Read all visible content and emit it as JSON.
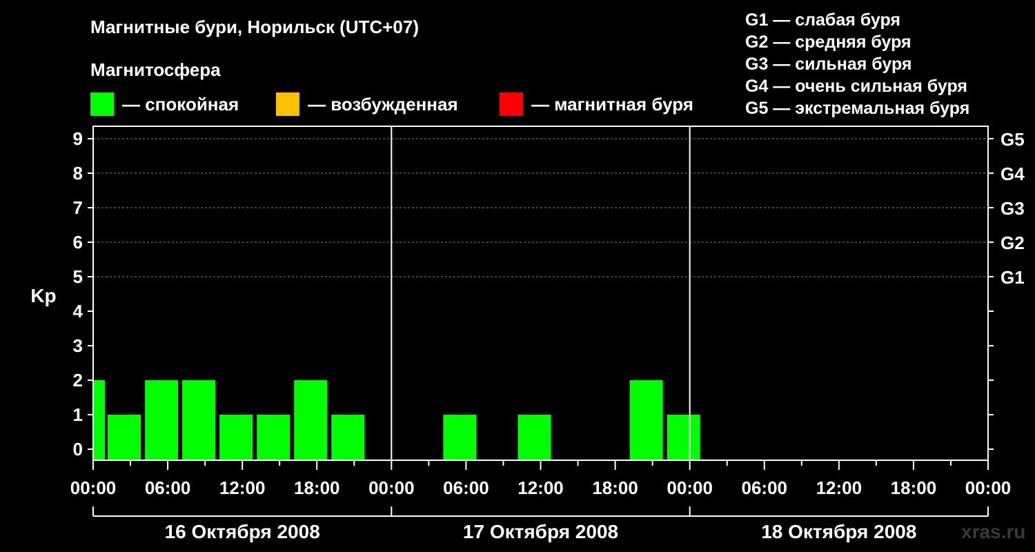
{
  "colors": {
    "quiet": "#00ff00",
    "active": "#ffc000",
    "storm": "#ff0000",
    "background": "#000000",
    "axis": "#ffffff",
    "grid": "#888888"
  },
  "legend": {
    "heading": "Магнитосфера",
    "items": [
      {
        "label": "— спокойная",
        "color": "#00ff00"
      },
      {
        "label": "— возбужденная",
        "color": "#ffc000"
      },
      {
        "label": "— магнитная буря",
        "color": "#ff0000"
      }
    ]
  },
  "g_legend": [
    "G1 — слабая буря",
    "G2 — средняя буря",
    "G3 — сильная буря",
    "G4 — очень сильная буря",
    "G5 — экстремальная буря"
  ],
  "watermark": "xras.ru",
  "chart_data": {
    "type": "bar",
    "title": "Магнитные бури, Норильск (UTC+07)",
    "ylabel": "Kp",
    "ylim": [
      0,
      9
    ],
    "yticks": [
      "0",
      "1",
      "2",
      "3",
      "4",
      "5",
      "6",
      "7",
      "8",
      "9"
    ],
    "right_axis": [
      {
        "kp": 5,
        "label": "G1"
      },
      {
        "kp": 6,
        "label": "G2"
      },
      {
        "kp": 7,
        "label": "G3"
      },
      {
        "kp": 8,
        "label": "G4"
      },
      {
        "kp": 9,
        "label": "G5"
      }
    ],
    "grid": true,
    "xticks": [
      "00:00",
      "06:00",
      "12:00",
      "18:00",
      "00:00",
      "06:00",
      "12:00",
      "18:00",
      "00:00",
      "06:00",
      "12:00",
      "18:00",
      "00:00"
    ],
    "days": [
      "16 Октября 2008",
      "17 Октября 2008",
      "18 Октября 2008"
    ],
    "series": [
      {
        "bars": [
          {
            "start": "2008-10-16 00:00",
            "end": "2008-10-16 01:00",
            "value": 2
          },
          {
            "start": "2008-10-16 01:00",
            "end": "2008-10-16 04:00",
            "value": 1
          },
          {
            "start": "2008-10-16 04:00",
            "end": "2008-10-16 07:00",
            "value": 2
          },
          {
            "start": "2008-10-16 07:00",
            "end": "2008-10-16 10:00",
            "value": 2
          },
          {
            "start": "2008-10-16 10:00",
            "end": "2008-10-16 13:00",
            "value": 1
          },
          {
            "start": "2008-10-16 13:00",
            "end": "2008-10-16 16:00",
            "value": 1
          },
          {
            "start": "2008-10-16 16:00",
            "end": "2008-10-16 19:00",
            "value": 2
          },
          {
            "start": "2008-10-16 19:00",
            "end": "2008-10-16 22:00",
            "value": 1
          },
          {
            "start": "2008-10-16 22:00",
            "end": "2008-10-17 01:00",
            "value": 0
          },
          {
            "start": "2008-10-17 01:00",
            "end": "2008-10-17 04:00",
            "value": 0
          },
          {
            "start": "2008-10-17 04:00",
            "end": "2008-10-17 07:00",
            "value": 1
          },
          {
            "start": "2008-10-17 07:00",
            "end": "2008-10-17 10:00",
            "value": 0
          },
          {
            "start": "2008-10-17 10:00",
            "end": "2008-10-17 13:00",
            "value": 1
          },
          {
            "start": "2008-10-17 13:00",
            "end": "2008-10-17 16:00",
            "value": 0
          },
          {
            "start": "2008-10-17 16:00",
            "end": "2008-10-17 19:00",
            "value": 0
          },
          {
            "start": "2008-10-17 19:00",
            "end": "2008-10-17 22:00",
            "value": 2
          },
          {
            "start": "2008-10-17 22:00",
            "end": "2008-10-18 01:00",
            "value": 1
          }
        ]
      }
    ]
  }
}
